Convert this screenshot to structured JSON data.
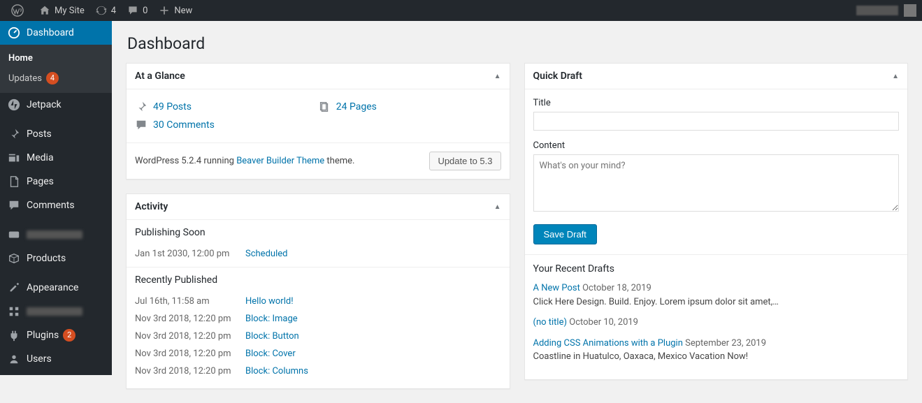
{
  "adminbar": {
    "site_name": "My Site",
    "updates_count": "4",
    "comments_count": "0",
    "new_label": "New"
  },
  "sidebar": {
    "items": [
      {
        "label": "Dashboard",
        "icon": "dashboard",
        "current": true
      },
      {
        "label": "Jetpack",
        "icon": "jetpack"
      },
      {
        "label": "Posts",
        "icon": "pin"
      },
      {
        "label": "Media",
        "icon": "media"
      },
      {
        "label": "Pages",
        "icon": "pages"
      },
      {
        "label": "Comments",
        "icon": "comment"
      },
      {
        "label": "",
        "icon": "woo",
        "blur": true
      },
      {
        "label": "Products",
        "icon": "products"
      },
      {
        "label": "Appearance",
        "icon": "appearance"
      },
      {
        "label": "",
        "icon": "grid",
        "blur": true
      },
      {
        "label": "Plugins",
        "icon": "plugin",
        "badge": "2"
      },
      {
        "label": "Users",
        "icon": "users"
      }
    ],
    "submenu": {
      "home": "Home",
      "updates": "Updates",
      "updates_badge": "4"
    }
  },
  "page_title": "Dashboard",
  "at_glance": {
    "title": "At a Glance",
    "posts": "49 Posts",
    "pages": "24 Pages",
    "comments": "30 Comments",
    "version_pre": "WordPress 5.2.4 running ",
    "theme": "Beaver Builder Theme",
    "version_post": " theme.",
    "update_button": "Update to 5.3"
  },
  "activity": {
    "title": "Activity",
    "publishing_soon": "Publishing Soon",
    "soon": [
      {
        "date": "Jan 1st 2030, 12:00 pm",
        "title": "Scheduled"
      }
    ],
    "recently_published": "Recently Published",
    "recent": [
      {
        "date": "Jul 16th, 11:58 am",
        "title": "Hello world!"
      },
      {
        "date": "Nov 3rd 2018, 12:20 pm",
        "title": "Block: Image"
      },
      {
        "date": "Nov 3rd 2018, 12:20 pm",
        "title": "Block: Button"
      },
      {
        "date": "Nov 3rd 2018, 12:20 pm",
        "title": "Block: Cover"
      },
      {
        "date": "Nov 3rd 2018, 12:20 pm",
        "title": "Block: Columns"
      }
    ]
  },
  "quick_draft": {
    "title": "Quick Draft",
    "title_label": "Title",
    "content_label": "Content",
    "content_placeholder": "What's on your mind?",
    "save": "Save Draft",
    "recent_heading": "Your Recent Drafts",
    "drafts": [
      {
        "title": "A New Post",
        "date": "October 18, 2019",
        "excerpt": "Click Here Design. Build. Enjoy. Lorem ipsum dolor sit amet,…"
      },
      {
        "title": "(no title)",
        "date": "October 10, 2019",
        "excerpt": ""
      },
      {
        "title": "Adding CSS Animations with a Plugin",
        "date": "September 23, 2019",
        "excerpt": "Coastline in Huatulco, Oaxaca, Mexico Vacation Now!"
      }
    ]
  }
}
